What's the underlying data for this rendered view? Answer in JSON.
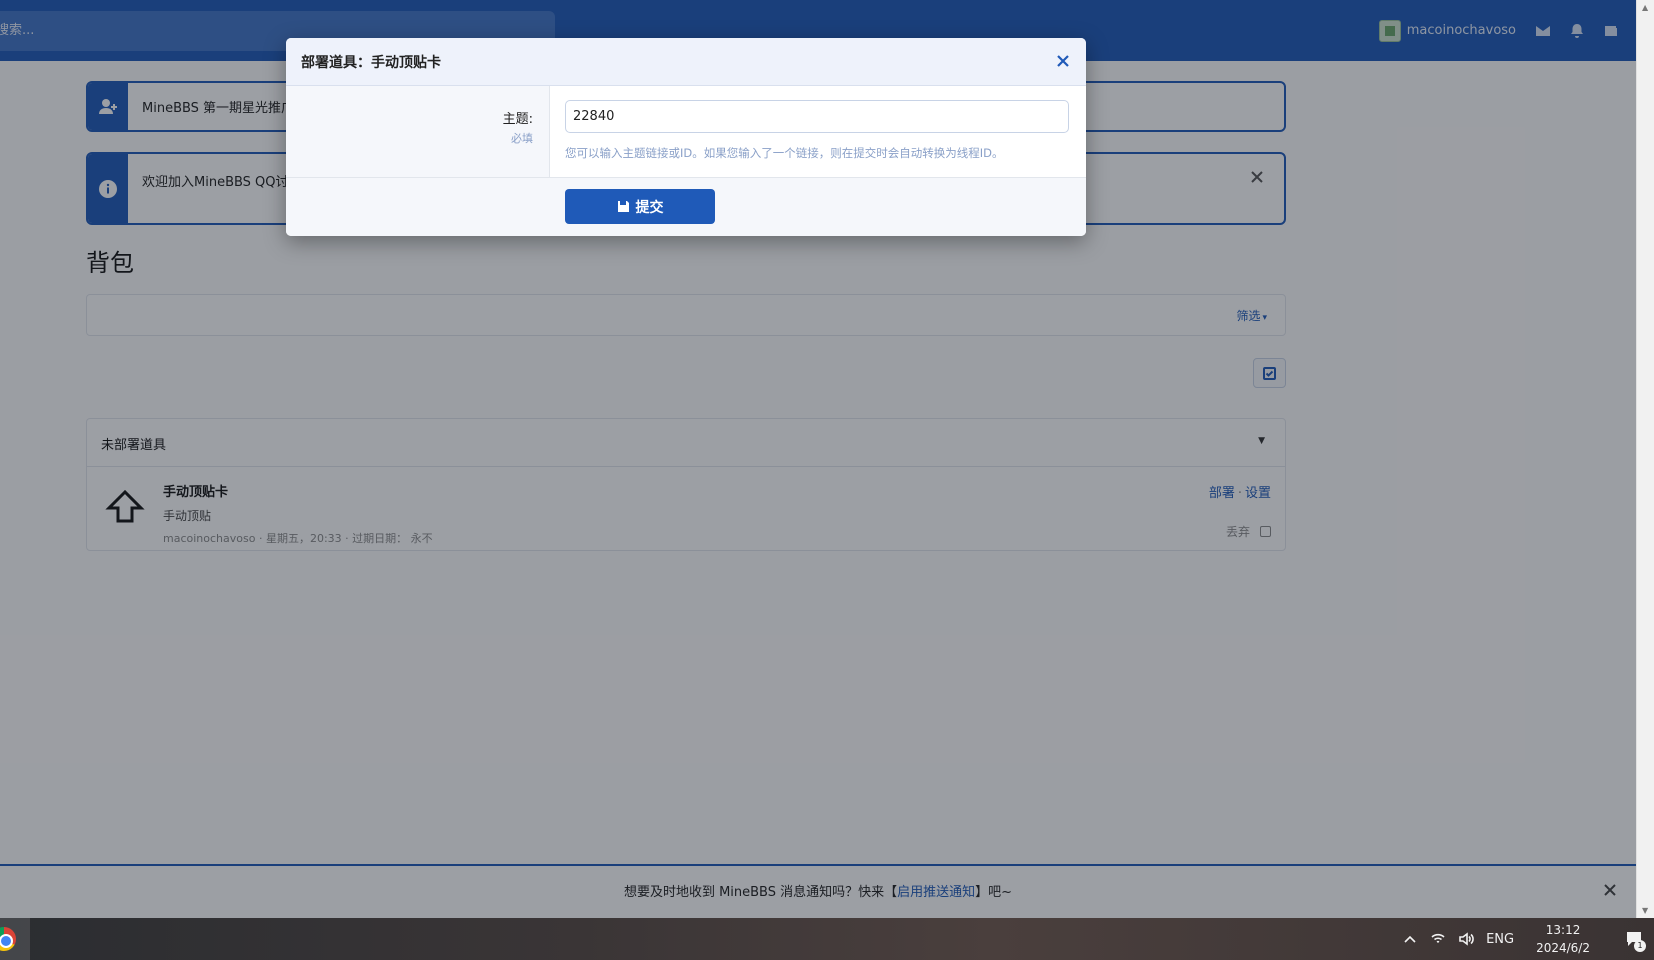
{
  "header": {
    "search_placeholder": "搜索...",
    "user_name": "macoinochavoso",
    "icons": [
      "envelope-icon",
      "bell-icon",
      "wallet-icon"
    ]
  },
  "notices": [
    {
      "text": "MineBBS 第一期星光推广",
      "icon": "user-plus-icon"
    },
    {
      "text": "欢迎加入MineBBS QQ讨",
      "icon": "info-icon"
    }
  ],
  "page": {
    "title": "背包",
    "filter_label": "筛选"
  },
  "inventory": {
    "section_title": "未部署道具",
    "items": [
      {
        "title": "手动顶贴卡",
        "description": "手动顶贴",
        "meta": "macoinochavoso · 星期五，20:33 · 过期日期： 永不",
        "action_deploy": "部署",
        "action_sep": "·",
        "action_settings": "设置",
        "discard_label": "丢弃"
      }
    ]
  },
  "modal": {
    "title": "部署道具：手动顶贴卡",
    "field_label": "主题:",
    "field_required": "必填",
    "field_value": "22840",
    "field_hint": "您可以输入主题链接或ID。如果您输入了一个链接，则在提交时会自动转换为线程ID。",
    "submit_label": "提交"
  },
  "push_bar": {
    "text_before": "想要及时地收到 MineBBS 消息通知吗？快来【",
    "link_text": "启用推送通知",
    "text_after": "】吧~"
  },
  "taskbar": {
    "language": "ENG",
    "time": "13:12",
    "date": "2024/6/2",
    "notification_count": "1"
  },
  "colors": {
    "brand": "#1f5ab8",
    "overlay": "#141a26"
  }
}
